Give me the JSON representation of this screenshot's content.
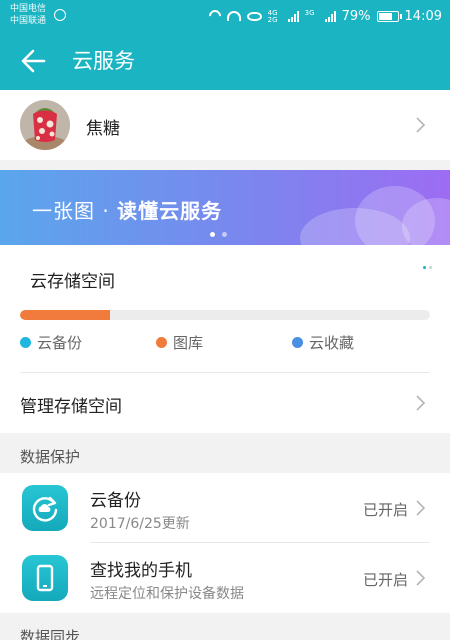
{
  "status_bar": {
    "carrier_1": "中国电信",
    "carrier_2": "中国联通",
    "net_1": "4G",
    "net_2": "2G",
    "net_3": "3G",
    "battery": "79%",
    "battery_level": 0.79,
    "time": "14:09"
  },
  "app_bar": {
    "title": "云服务",
    "back_icon": "arrow-left-icon"
  },
  "profile": {
    "name": "焦糖",
    "avatar_icon": "user-avatar"
  },
  "banner": {
    "text_prefix": "一张图 · ",
    "text_bold": "读懂云服务",
    "slides": 2,
    "active_slide": 1
  },
  "storage": {
    "title": "云存储空间",
    "usage_fraction": 0.22,
    "legend": [
      {
        "label": "云备份",
        "color": "#1fb7df"
      },
      {
        "label": "图库",
        "color": "#f07b3c"
      },
      {
        "label": "云收藏",
        "color": "#4a90e2"
      }
    ],
    "manage_label": "管理存储空间"
  },
  "sections": {
    "data_protection": "数据保护",
    "data_sync": "数据同步"
  },
  "services": [
    {
      "title": "云备份",
      "subtitle": "2017/6/25更新",
      "status": "已开启",
      "icon": "cloud-backup-icon"
    },
    {
      "title": "查找我的手机",
      "subtitle": "远程定位和保护设备数据",
      "status": "已开启",
      "icon": "find-phone-icon"
    }
  ],
  "colors": {
    "accent": "#1ab4c3",
    "storage_bar": "#f07b3c"
  }
}
